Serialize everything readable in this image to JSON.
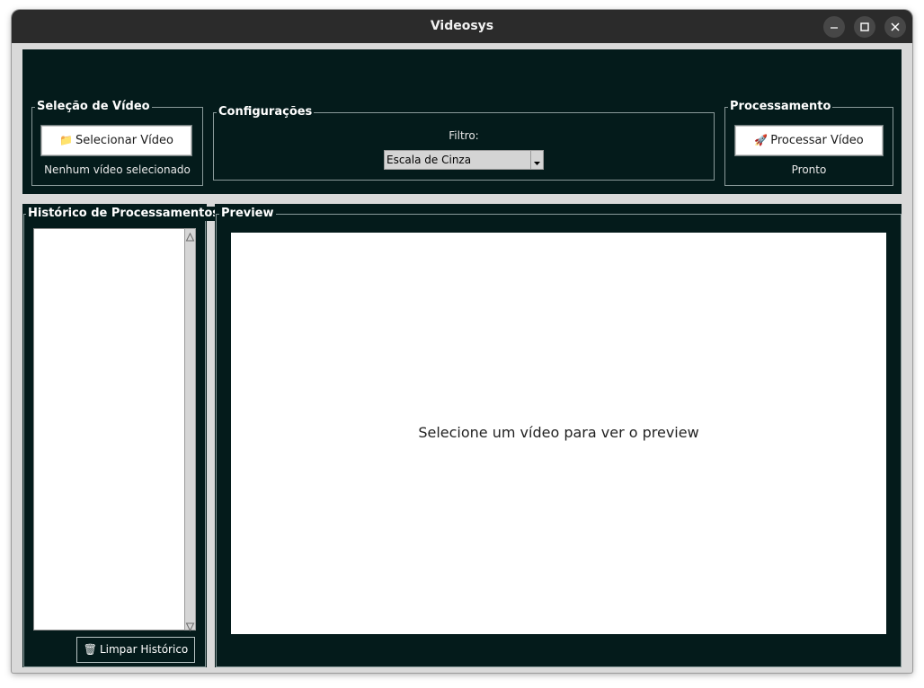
{
  "window": {
    "title": "Videosys"
  },
  "titlebar_buttons": {
    "minimize_icon": "minimize-icon",
    "maximize_icon": "maximize-icon",
    "close_icon": "close-icon"
  },
  "video_selection": {
    "group_title": "Seleção de Vídeo",
    "button_icon": "📁",
    "button_label": "Selecionar Vídeo",
    "status": "Nenhum vídeo selecionado"
  },
  "settings": {
    "group_title": "Configurações",
    "filter_label": "Filtro:",
    "filter_selected": "Escala de Cinza"
  },
  "processing": {
    "group_title": "Processamento",
    "button_icon": "🚀",
    "button_label": "Processar Vídeo",
    "status": "Pronto"
  },
  "history": {
    "group_title": "Histórico de Processamentos",
    "items": [],
    "clear_icon": "🗑",
    "clear_label": "Limpar Histórico"
  },
  "preview": {
    "group_title": "Preview",
    "placeholder": "Selecione um vídeo para ver o preview"
  },
  "colors": {
    "panel_bg": "#041b1b",
    "window_bg": "#d9d9d9",
    "titlebar_bg": "#2b2b2b"
  }
}
